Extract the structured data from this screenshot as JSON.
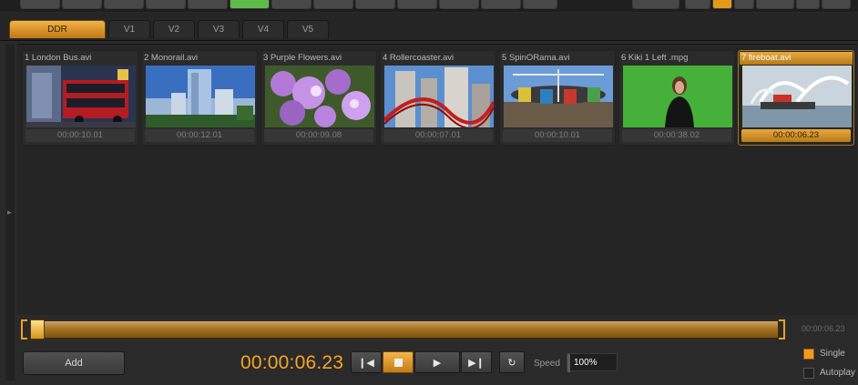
{
  "tabs": [
    {
      "label": "DDR",
      "active": true
    },
    {
      "label": "V1",
      "active": false
    },
    {
      "label": "V2",
      "active": false
    },
    {
      "label": "V3",
      "active": false
    },
    {
      "label": "V4",
      "active": false
    },
    {
      "label": "V5",
      "active": false
    }
  ],
  "clips": [
    {
      "name": "1 London Bus.avi",
      "duration": "00:00:10.01",
      "selected": false
    },
    {
      "name": "2 Monorail.avi",
      "duration": "00:00:12.01",
      "selected": false
    },
    {
      "name": "3 Purple Flowers.avi",
      "duration": "00:00:09.08",
      "selected": false
    },
    {
      "name": "4 Rollercoaster.avi",
      "duration": "00:00:07.01",
      "selected": false
    },
    {
      "name": "5 SpinORama.avi",
      "duration": "00:00:10.01",
      "selected": false
    },
    {
      "name": "6 Kiki 1 Left .mpg",
      "duration": "00:00:38.02",
      "selected": false
    },
    {
      "name": "7 fireboat.avi",
      "duration": "00:00:06.23",
      "selected": true
    }
  ],
  "scrubber": {
    "end_timecode": "00:00:06.23",
    "position": 0
  },
  "controls": {
    "add_label": "Add",
    "timecode": "00:00:06.23",
    "speed_label": "Speed",
    "speed_value": "100%",
    "single_label": "Single",
    "single_checked": true,
    "autoplay_label": "Autoplay",
    "autoplay_checked": false
  },
  "colors": {
    "accent": "#f4a526",
    "background": "#2a2a2a",
    "panel": "#252525"
  }
}
